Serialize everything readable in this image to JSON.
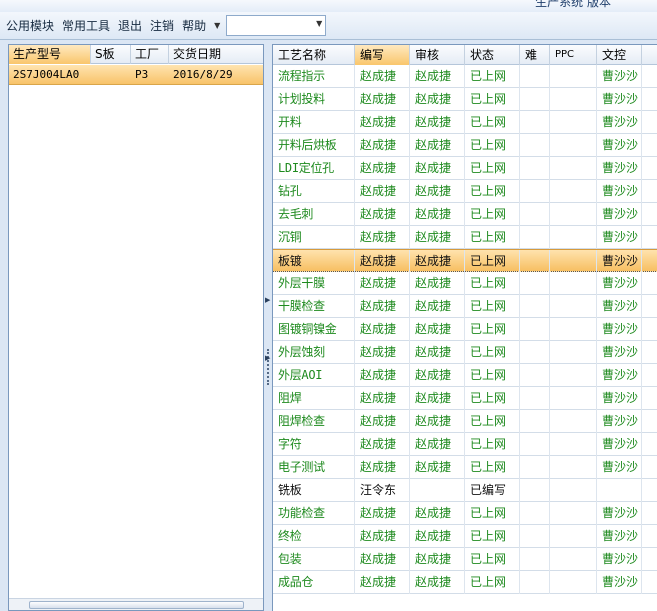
{
  "window": {
    "title": "生产系统 版本"
  },
  "menubar": {
    "items": [
      "公用模块",
      "常用工具",
      "退出",
      "注销",
      "帮助"
    ],
    "combo_value": ""
  },
  "left_grid": {
    "columns": [
      "生产型号",
      "S板",
      "工厂",
      "交货日期"
    ],
    "rows": [
      {
        "model": "2S7J004LA0",
        "s_board": "",
        "factory": "P3",
        "delivery_date": "2016/8/29"
      }
    ]
  },
  "right_grid": {
    "columns": [
      "工艺名称",
      "编写",
      "审核",
      "状态",
      "难",
      "PPC",
      "文控"
    ],
    "rows": [
      {
        "process": "流程指示",
        "author": "赵成捷",
        "reviewer": "赵成捷",
        "status": "已上网",
        "doc": "曹沙沙"
      },
      {
        "process": "计划投料",
        "author": "赵成捷",
        "reviewer": "赵成捷",
        "status": "已上网",
        "doc": "曹沙沙"
      },
      {
        "process": "开料",
        "author": "赵成捷",
        "reviewer": "赵成捷",
        "status": "已上网",
        "doc": "曹沙沙"
      },
      {
        "process": "开料后烘板",
        "author": "赵成捷",
        "reviewer": "赵成捷",
        "status": "已上网",
        "doc": "曹沙沙"
      },
      {
        "process": "LDI定位孔",
        "author": "赵成捷",
        "reviewer": "赵成捷",
        "status": "已上网",
        "doc": "曹沙沙"
      },
      {
        "process": "钻孔",
        "author": "赵成捷",
        "reviewer": "赵成捷",
        "status": "已上网",
        "doc": "曹沙沙"
      },
      {
        "process": "去毛刺",
        "author": "赵成捷",
        "reviewer": "赵成捷",
        "status": "已上网",
        "doc": "曹沙沙"
      },
      {
        "process": "沉铜",
        "author": "赵成捷",
        "reviewer": "赵成捷",
        "status": "已上网",
        "doc": "曹沙沙"
      },
      {
        "process": "板镀",
        "author": "赵成捷",
        "reviewer": "赵成捷",
        "status": "已上网",
        "doc": "曹沙沙"
      },
      {
        "process": "外层干膜",
        "author": "赵成捷",
        "reviewer": "赵成捷",
        "status": "已上网",
        "doc": "曹沙沙"
      },
      {
        "process": "干膜检查",
        "author": "赵成捷",
        "reviewer": "赵成捷",
        "status": "已上网",
        "doc": "曹沙沙"
      },
      {
        "process": "图镀铜镍金",
        "author": "赵成捷",
        "reviewer": "赵成捷",
        "status": "已上网",
        "doc": "曹沙沙"
      },
      {
        "process": "外层蚀刻",
        "author": "赵成捷",
        "reviewer": "赵成捷",
        "status": "已上网",
        "doc": "曹沙沙"
      },
      {
        "process": "外层AOI",
        "author": "赵成捷",
        "reviewer": "赵成捷",
        "status": "已上网",
        "doc": "曹沙沙"
      },
      {
        "process": "阻焊",
        "author": "赵成捷",
        "reviewer": "赵成捷",
        "status": "已上网",
        "doc": "曹沙沙"
      },
      {
        "process": "阻焊检查",
        "author": "赵成捷",
        "reviewer": "赵成捷",
        "status": "已上网",
        "doc": "曹沙沙"
      },
      {
        "process": "字符",
        "author": "赵成捷",
        "reviewer": "赵成捷",
        "status": "已上网",
        "doc": "曹沙沙"
      },
      {
        "process": "电子测试",
        "author": "赵成捷",
        "reviewer": "赵成捷",
        "status": "已上网",
        "doc": "曹沙沙"
      },
      {
        "process": "铣板",
        "author": "汪令东",
        "reviewer": "",
        "status": "已编写",
        "doc": ""
      },
      {
        "process": "功能检查",
        "author": "赵成捷",
        "reviewer": "赵成捷",
        "status": "已上网",
        "doc": "曹沙沙"
      },
      {
        "process": "终检",
        "author": "赵成捷",
        "reviewer": "赵成捷",
        "status": "已上网",
        "doc": "曹沙沙"
      },
      {
        "process": "包装",
        "author": "赵成捷",
        "reviewer": "赵成捷",
        "status": "已上网",
        "doc": "曹沙沙"
      },
      {
        "process": "成品仓",
        "author": "赵成捷",
        "reviewer": "赵成捷",
        "status": "已上网",
        "doc": "曹沙沙"
      }
    ],
    "selected_row": 8,
    "plain_row": 18
  },
  "colors": {
    "accent": "#f8c36a",
    "text_green": "#1e8a1e",
    "header_bg": "#e5ecf5"
  }
}
